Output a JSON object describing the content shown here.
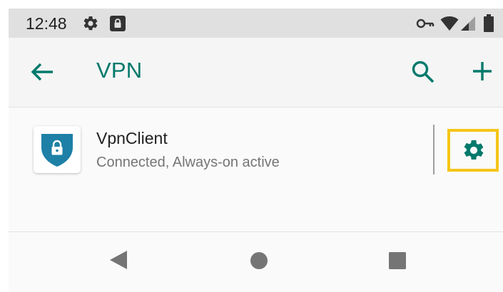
{
  "status_bar": {
    "time": "12:48",
    "icons": [
      "gear-icon",
      "lock-icon",
      "key-icon",
      "wifi-icon",
      "signal-icon",
      "battery-icon"
    ]
  },
  "app_bar": {
    "title": "VPN",
    "actions": [
      "search-icon",
      "add-icon"
    ],
    "accent_color": "#00796b"
  },
  "vpn_list": {
    "items": [
      {
        "name": "VpnClient",
        "status": "Connected, Always-on active",
        "icon": "shield-lock-icon",
        "action_icon": "gear-icon"
      }
    ]
  },
  "nav_bar": {
    "buttons": [
      "back-triangle-icon",
      "home-circle-icon",
      "recents-square-icon"
    ]
  }
}
